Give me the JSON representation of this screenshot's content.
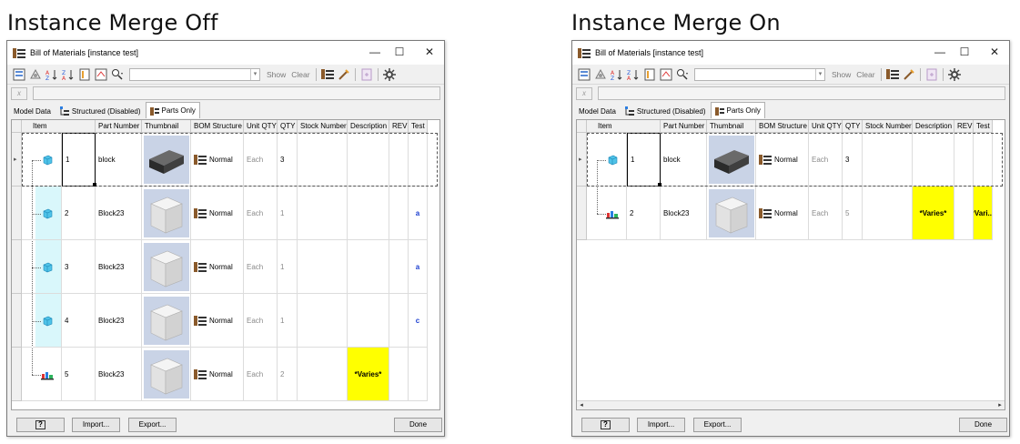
{
  "captions": {
    "left": "Instance Merge Off",
    "right": "Instance Merge On"
  },
  "window": {
    "title": "Bill of Materials [instance test]",
    "controls": {
      "minimize": "—",
      "maximize": "☐",
      "close": "✕"
    },
    "toolbar": {
      "show_label": "Show",
      "clear_label": "Clear"
    },
    "formula_icon": "x",
    "tabs": [
      "Model Data",
      "Structured (Disabled)",
      "Parts Only"
    ],
    "active_tab": "Parts Only",
    "columns": [
      "Item",
      "Part Number",
      "Thumbnail",
      "BOM Structure",
      "Unit QTY",
      "QTY",
      "Stock Number",
      "Description",
      "REV",
      "Test"
    ],
    "buttons": {
      "help": "?",
      "import": "Import...",
      "export": "Export...",
      "done": "Done"
    }
  },
  "left_rows": [
    {
      "item": "1",
      "part_number": "block",
      "bom_structure": "",
      "unit_qty": "Each",
      "qty": "3",
      "description": "",
      "rev": "",
      "test": "",
      "thumb": "dark"
    },
    {
      "item": "2",
      "part_number": "Block23",
      "bom_structure": "Normal",
      "unit_qty": "Each",
      "qty": "1",
      "description": "",
      "rev": "",
      "test": "a",
      "thumb": "light"
    },
    {
      "item": "3",
      "part_number": "Block23",
      "bom_structure": "Normal",
      "unit_qty": "Each",
      "qty": "1",
      "description": "",
      "rev": "",
      "test": "a",
      "thumb": "light"
    },
    {
      "item": "4",
      "part_number": "Block23",
      "bom_structure": "Normal",
      "unit_qty": "Each",
      "qty": "1",
      "description": "",
      "rev": "",
      "test": "c",
      "thumb": "light"
    },
    {
      "item": "5",
      "part_number": "Block23",
      "bom_structure": "Normal",
      "unit_qty": "Each",
      "qty": "2",
      "description": "*Varies*",
      "rev": "",
      "test": "",
      "thumb": "light"
    }
  ],
  "right_rows": [
    {
      "item": "1",
      "part_number": "block",
      "bom_structure": "Normal",
      "unit_qty": "Each",
      "qty": "3",
      "description": "",
      "rev": "",
      "test": "",
      "thumb": "dark"
    },
    {
      "item": "2",
      "part_number": "Block23",
      "bom_structure": "Normal",
      "unit_qty": "Each",
      "qty": "5",
      "description": "*Varies*",
      "rev": "",
      "test": "*Vari...",
      "thumb": "light"
    }
  ],
  "left_first_row_bom": "Normal",
  "colors": {
    "varies_bg": "#ffff00",
    "test_text": "#1c3fd0",
    "thumb_bg": "#c9d3e6",
    "selection_bg": "#d9f7fb"
  }
}
